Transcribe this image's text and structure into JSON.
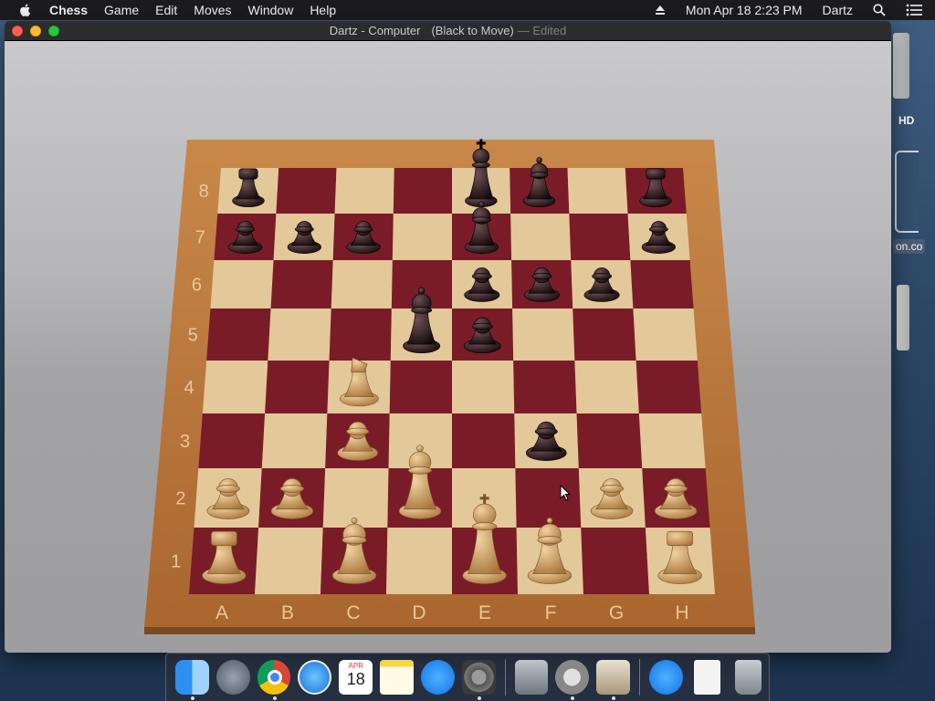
{
  "menubar": {
    "app_name": "Chess",
    "menus": [
      "Game",
      "Edit",
      "Moves",
      "Window",
      "Help"
    ],
    "datetime": "Mon Apr 18  2:23 PM",
    "user": "Dartz"
  },
  "window": {
    "title": "Dartz - Computer",
    "status": "(Black to Move)",
    "edited": "— Edited"
  },
  "board": {
    "files": [
      "A",
      "B",
      "C",
      "D",
      "E",
      "F",
      "G",
      "H"
    ],
    "ranks": [
      "8",
      "7",
      "6",
      "5",
      "4",
      "3",
      "2",
      "1"
    ],
    "light_square": "#e3c89a",
    "dark_square": "#7a1c28",
    "frame_color": "#b8773e",
    "white_piece": "#c99a5c",
    "black_piece": "#2a1a1c",
    "pieces": [
      {
        "sq": "a8",
        "color": "black",
        "type": "rook"
      },
      {
        "sq": "e8",
        "color": "black",
        "type": "king"
      },
      {
        "sq": "f8",
        "color": "black",
        "type": "bishop"
      },
      {
        "sq": "h8",
        "color": "black",
        "type": "rook"
      },
      {
        "sq": "a7",
        "color": "black",
        "type": "pawn"
      },
      {
        "sq": "b7",
        "color": "black",
        "type": "pawn"
      },
      {
        "sq": "c7",
        "color": "black",
        "type": "pawn"
      },
      {
        "sq": "e7",
        "color": "black",
        "type": "bishop"
      },
      {
        "sq": "h7",
        "color": "black",
        "type": "pawn"
      },
      {
        "sq": "e6",
        "color": "black",
        "type": "pawn"
      },
      {
        "sq": "f6",
        "color": "black",
        "type": "pawn"
      },
      {
        "sq": "g6",
        "color": "black",
        "type": "pawn"
      },
      {
        "sq": "d5",
        "color": "black",
        "type": "queen"
      },
      {
        "sq": "e5",
        "color": "black",
        "type": "pawn"
      },
      {
        "sq": "f3",
        "color": "black",
        "type": "pawn"
      },
      {
        "sq": "c4",
        "color": "white",
        "type": "knight"
      },
      {
        "sq": "c3",
        "color": "white",
        "type": "pawn"
      },
      {
        "sq": "a2",
        "color": "white",
        "type": "pawn"
      },
      {
        "sq": "b2",
        "color": "white",
        "type": "pawn"
      },
      {
        "sq": "d2",
        "color": "white",
        "type": "queen"
      },
      {
        "sq": "g2",
        "color": "white",
        "type": "pawn"
      },
      {
        "sq": "h2",
        "color": "white",
        "type": "pawn"
      },
      {
        "sq": "a1",
        "color": "white",
        "type": "rook"
      },
      {
        "sq": "c1",
        "color": "white",
        "type": "bishop"
      },
      {
        "sq": "e1",
        "color": "white",
        "type": "king"
      },
      {
        "sq": "f1",
        "color": "white",
        "type": "bishop"
      },
      {
        "sq": "h1",
        "color": "white",
        "type": "rook"
      }
    ]
  },
  "desktop": {
    "hd_label": "HD",
    "app_label": "on.co"
  },
  "dock": {
    "calendar_month": "APR",
    "calendar_day": "18",
    "items": [
      "finder-icon",
      "launchpad-icon",
      "chrome-icon",
      "safari-icon",
      "calendar-icon",
      "notes-icon",
      "app-store-icon",
      "system-preferences-icon",
      "disk-utility-icon",
      "instruments-icon",
      "chess-icon",
      "app-store-icon",
      "document-icon",
      "trash-icon"
    ]
  }
}
